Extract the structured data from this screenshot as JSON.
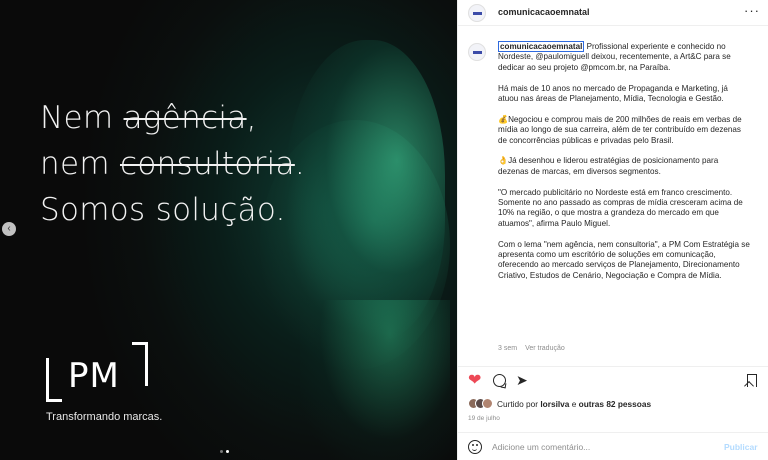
{
  "media": {
    "headline": {
      "line1_a": "Nem ",
      "line1_strike": "agência",
      "line1_b": ",",
      "line2_a": "nem ",
      "line2_strike": "consultoria",
      "line2_b": ".",
      "line3": "Somos solução."
    },
    "logo_text": "PM",
    "tagline": "Transformando marcas.",
    "prev_icon": "chevron-left-icon",
    "slide_count": 2,
    "active_slide": 2
  },
  "header": {
    "username": "comunicacaoemnatal",
    "more_icon": "more-horizontal-icon"
  },
  "caption": {
    "username": "comunicacaoemnatal",
    "p1_text": " Profissional experiente e conhecido no Nordeste, @paulomiguell deixou, recentemente, a Art&C para se dedicar ao seu projeto @pmcom.br, na Paraíba.",
    "p2": "Há mais de 10 anos no mercado de Propaganda e Marketing, já atuou nas áreas de Planejamento, Mídia, Tecnologia e Gestão.",
    "p3": "💰Negociou e comprou mais de 200 milhões de reais em verbas de mídia ao longo de sua carreira, além de ter contribuído em dezenas de concorrências públicas e privadas pelo Brasil.",
    "p4": "👌Já desenhou e liderou estratégias de posicionamento para dezenas de marcas, em diversos segmentos.",
    "p5": "\"O mercado publicitário no Nordeste está em franco crescimento. Somente no ano passado as compras de mídia cresceram acima de 10% na região, o que mostra a grandeza do mercado em que atuamos\", afirma Paulo Miguel.",
    "p6": "Com o lema \"nem agência, nem consultoria\", a PM Com Estratégia se apresenta como um escritório de soluções em comunicação, oferecendo ao mercado serviços de Planejamento, Direcionamento Criativo, Estudos de Cenário, Negociação e Compra de Mídia.",
    "time_ago": "3 sem",
    "translate": "Ver tradução"
  },
  "actions": {
    "like_icon": "heart-filled-icon",
    "comment_icon": "comment-icon",
    "share_icon": "share-icon",
    "save_icon": "bookmark-icon",
    "like_color": "#ed4956"
  },
  "likes": {
    "prefix": "Curtido por ",
    "user": "lorsilva",
    "middle": " e ",
    "others": "outras 82 pessoas"
  },
  "date": "19 de julho",
  "add_comment": {
    "placeholder": "Adicione um comentário...",
    "publish": "Publicar"
  }
}
